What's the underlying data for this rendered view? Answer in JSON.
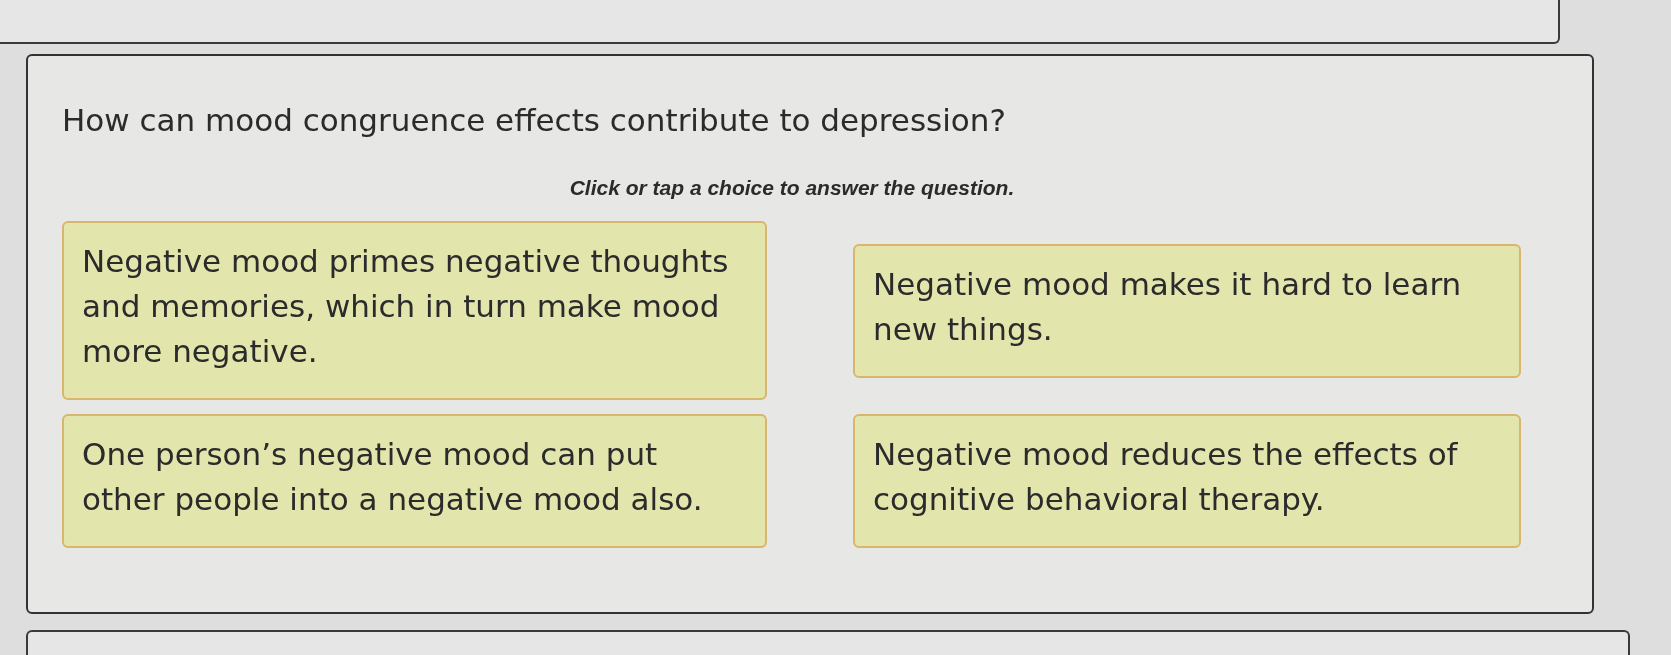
{
  "question": "How can mood congruence effects contribute to depression?",
  "instruction": "Click or tap a choice to answer the question.",
  "choices": [
    {
      "text": "Negative mood primes negative thoughts and memories, which in turn make mood more negative.",
      "selected": false
    },
    {
      "text": "Negative mood makes it hard to learn new things.",
      "selected": false
    },
    {
      "text": "One person’s negative mood can put other people into a negative mood also.",
      "selected": false
    },
    {
      "text": "Negative mood reduces the effects of cognitive behavioral therapy.",
      "selected": false
    }
  ]
}
